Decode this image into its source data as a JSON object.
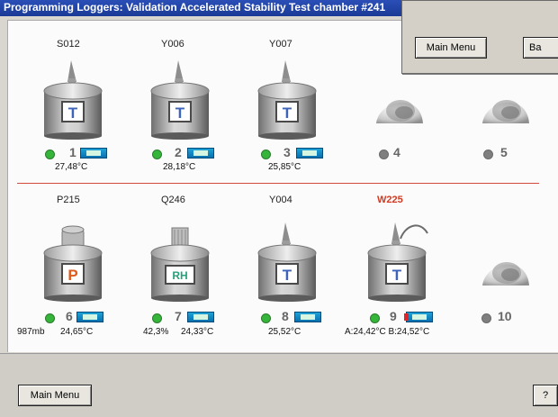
{
  "window": {
    "title": "Programming Loggers: Validation Accelerated Stability Test chamber #241"
  },
  "popup": {
    "main_menu_label": "Main Menu",
    "truncated_button_label": "Ba"
  },
  "top_row": {
    "loggers": [
      {
        "label": "S012",
        "type": "T",
        "slot": "1",
        "status": "green",
        "reading": "27,48°C"
      },
      {
        "label": "Y006",
        "type": "T",
        "slot": "2",
        "status": "green",
        "reading": "28,18°C"
      },
      {
        "label": "Y007",
        "type": "T",
        "slot": "3",
        "status": "green",
        "reading": "25,85°C"
      }
    ],
    "empty_slots": [
      {
        "slot": "4",
        "status": "gray"
      },
      {
        "slot": "5",
        "status": "gray"
      }
    ]
  },
  "bottom_row": {
    "loggers": [
      {
        "label": "P215",
        "type": "P",
        "slot": "6",
        "status": "green",
        "reading_left": "987mb",
        "reading_right": "24,65°C"
      },
      {
        "label": "Q246",
        "type": "RH",
        "slot": "7",
        "status": "green",
        "reading_left": "42,3%",
        "reading_right": "24,33°C"
      },
      {
        "label": "Y004",
        "type": "T",
        "slot": "8",
        "status": "green",
        "reading": "25,52°C"
      },
      {
        "label": "W225",
        "type": "T",
        "slot": "9",
        "status": "green",
        "reading": "A:24,42°C B:24,52°C",
        "warning": true
      }
    ],
    "empty_slots": [
      {
        "slot": "10",
        "status": "gray"
      }
    ]
  },
  "bottom_bar": {
    "main_menu_label": "Main Menu",
    "help_label": "?"
  },
  "colors": {
    "title_bar": "#1b3a96",
    "ok_status": "#35b53a",
    "empty_status": "#7f7f7f",
    "warning_label": "#d13a22",
    "divider": "#d34a3c",
    "type_T": "#3d64b8",
    "type_P": "#e05a1e",
    "type_RH": "#2aa07a"
  },
  "icons": {
    "logger": "logger-canister-icon",
    "battery": "battery-icon",
    "empty_slot": "empty-slot-bowl-icon",
    "status": "status-dot-icon"
  }
}
